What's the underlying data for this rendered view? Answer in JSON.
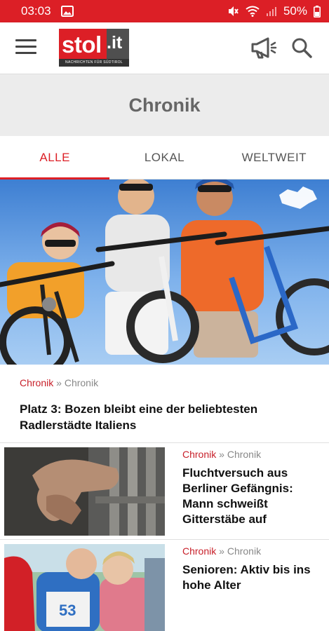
{
  "status_bar": {
    "time": "03:03",
    "battery": "50%"
  },
  "app_bar": {
    "logo_text": "stol",
    "logo_suffix": ".it",
    "logo_tagline": "NACHRICHTEN FÜR SÜDTIROL"
  },
  "section": {
    "title": "Chronik"
  },
  "tabs": [
    {
      "label": "ALLE",
      "active": true
    },
    {
      "label": "LOKAL",
      "active": false
    },
    {
      "label": "WELTWEIT",
      "active": false
    }
  ],
  "lead_article": {
    "category": "Chronik",
    "separator": "»",
    "subcategory": "Chronik",
    "title": "Platz 3: Bozen bleibt eine der beliebtesten Radlerstädte Italiens"
  },
  "articles": [
    {
      "category": "Chronik",
      "separator": "»",
      "subcategory": "Chronik",
      "title": "Fluchtversuch aus Berliner Gefängnis: Mann schweißt Gitterstäbe auf"
    },
    {
      "category": "Chronik",
      "separator": "»",
      "subcategory": "Chronik",
      "title": "Senioren: Aktiv bis ins hohe Alter"
    }
  ],
  "colors": {
    "brand_red": "#dc1f26",
    "header_bg": "#ececec",
    "meta_gray": "#888888"
  }
}
